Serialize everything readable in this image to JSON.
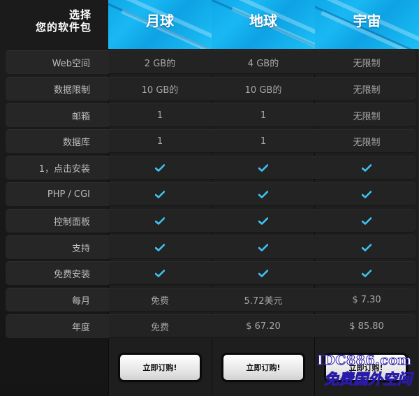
{
  "header": {
    "corner_line1": "选择",
    "corner_line2": "您的软件包",
    "plans": [
      "月球",
      "地球",
      "宇宙"
    ]
  },
  "rows": [
    {
      "label": "Web空间",
      "values": [
        "2 GB的",
        "4 GB的",
        "无限制"
      ]
    },
    {
      "label": "数据限制",
      "values": [
        "10 GB的",
        "10 GB的",
        "无限制"
      ]
    },
    {
      "label": "邮箱",
      "values": [
        "1",
        "1",
        "无限制"
      ]
    },
    {
      "label": "数据库",
      "values": [
        "1",
        "1",
        "无限制"
      ]
    },
    {
      "label": "1，点击安装",
      "values": [
        "check",
        "check",
        "check"
      ]
    },
    {
      "label": "PHP / CGI",
      "values": [
        "check",
        "check",
        "check"
      ]
    },
    {
      "label": "控制面板",
      "values": [
        "check",
        "check",
        "check"
      ]
    },
    {
      "label": "支持",
      "values": [
        "check",
        "check",
        "check"
      ]
    },
    {
      "label": "免费安装",
      "values": [
        "check",
        "check",
        "check"
      ]
    },
    {
      "label": "每月",
      "values": [
        "免费",
        "5.72美元",
        "$ 7.30"
      ]
    },
    {
      "label": "年度",
      "values": [
        "免费",
        "$ 67.20",
        "$ 85.80"
      ]
    }
  ],
  "buttons": [
    "立即订购!",
    "立即订购!",
    "立即订购!"
  ],
  "watermark": {
    "line1": "IDC886.com",
    "line2": "免费国外空间"
  },
  "colors": {
    "accent_blue": "#19b8f3",
    "check_blue": "#3fc3f2",
    "background": "#141414"
  },
  "icons": {
    "check": "check-icon"
  }
}
